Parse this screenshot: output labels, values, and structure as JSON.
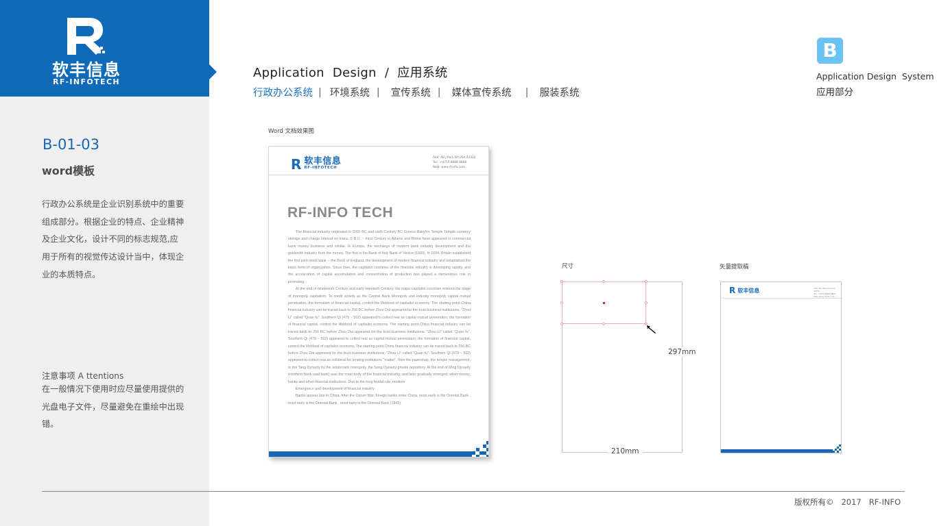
{
  "brand": {
    "logo_letter": "R",
    "name_cn": "软丰信息",
    "name_en": "RF-INFOTECH",
    "color": "#0f6ab8"
  },
  "sidebar": {
    "code": "B-01-03",
    "subtitle": "word模板",
    "description": "行政办公系统是企业识别系统中的重要组成部分。根据企业的特点、企业精神及企业文化，设计不同的标志规范,应用于所有的视觉传达设计当中，体现企业的本质特点。",
    "attention_title": "注意事项 A ttentions",
    "attention_text": "在一般情况下使用时应尽量使用提供的光盘电子文件，尽量避免在重绘中出现错。"
  },
  "header": {
    "title": "Application  Design  /  应用系统",
    "tabs": [
      {
        "label": "行政办公系统",
        "active": true
      },
      {
        "label": "环境系统",
        "active": false
      },
      {
        "label": "宣传系统",
        "active": false
      },
      {
        "label": "媒体宣传系统",
        "active": false
      },
      {
        "label": "服装系统",
        "active": false
      }
    ],
    "separator": "|"
  },
  "section_badge": {
    "letter": "B",
    "title_en": "Application Design  System",
    "title_cn": "应用部分",
    "color": "#6ac3f3"
  },
  "word_preview": {
    "caption": "Word 文档效果图",
    "logo_letter": "R",
    "logo_cn": "软丰信息",
    "logo_en": "RF-INFOTECH",
    "contact": [
      "Add: AB J.Park NY-USA 43320",
      "Tel:  +0755 8888 8888",
      "Web: www.rf-info.com"
    ],
    "doc_title": "RF-INFO TECH",
    "paragraphs": [
      "The financial industry originated in 2000 BC and sixth Century BC Greece Babylon Temple Temple currency storage and charge interest on loans. 5 B.C. ~ third Century in Athens and Rome have appeared in commercial bank money business and similar. In Europe, the exchange of modern bank industry development and the goldsmith industry from the money. The first is the Bank of Italy Bank of Venice (1580). In 1694, Britain established the first joint-stock bank -- the Bank of England, the development of modern financial industry and established the basic form of organization. Since then, the capitalist countries of the financial industry is developing rapidly, and the acceleration of capital accumulation and concentration of production has played a tremendous role in promoting.",
      "At the end of nineteenth Century and early twentieth Century, the major capitalist countries entered the stage of monopoly capitalism. To credit activity as the Central Bank Monopoly and industry monopoly capital mutual penetration, the formation of financial capital, control the lifeblood of capitalist economy. The starting point China financial industry can be traced back to 256 BC before Zhou Dai appeared for the trust business institutions, \"Zhou Li\" called \"Quan fu\". Southern Qi (479 ~ 502) appeared to collect real as capital mutual penetration, the formation of financial capital, control the lifeblood of capitalist economy. The starting point China financial industry can be traced back to 256 BC before Zhou Dai appeared for the trust business institutions, \"Zhou Li\" called \"Quan fu\". Southern Qi (479 ~ 502) appeared to collect real as capital mutual penetration, the formation of financial capital, control the lifeblood of capitalist economy. The starting point China financial industry can be traced back to 256 BC before Zhou Dai appeared for the trust business institutions, \"Zhou Li\" called \"Quan fu\". Southern Qi (479 ~ 502) appeared to collect real as collateral for lending institutions \"matter\", then the pawnshop, the temple management, to the Tang Dynasty by the aristocratic monopoly, the Song Dynasty private repository. At the end of Ming Dynasty (northern bank said bank) was the main body of the financial industry, and later gradually emerged, silver money, banks and other financial institutions. Due to the long feudal rule, modern",
      "Emergence and development of financial industry",
      "Banks appear late in China. After the Opium War, foreign banks enter China, most early is the Oriental Bank , most early is the Oriental Bank , most early is the Oriental Bank (1845)."
    ]
  },
  "dimensions": {
    "caption": "尺寸",
    "height_label": "297mm",
    "width_label": "210mm",
    "selection_color": "#f0a9c6"
  },
  "vector_preview": {
    "caption": "矢量提取稿",
    "logo_letter": "R",
    "logo_cn": "软丰信息",
    "contact": [
      "Add: AB J.Park NY-USA 43320",
      "Tel:  +0755 8888 8888",
      "Web: www.rf-info.com"
    ]
  },
  "footer": {
    "copyright": "版权所有©   2017   RF-INFO"
  }
}
